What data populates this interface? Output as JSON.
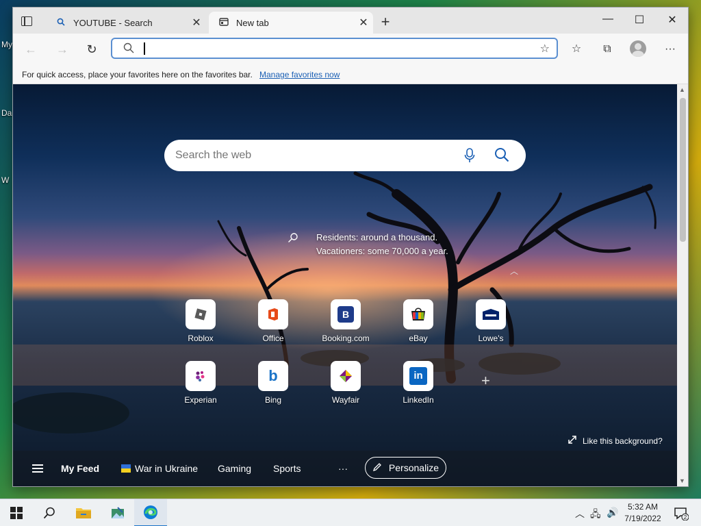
{
  "desktop": {
    "labels": [
      "My",
      "Da",
      "W"
    ]
  },
  "browser": {
    "tabs": [
      {
        "title": "YOUTUBE - Search",
        "active": false
      },
      {
        "title": "New tab",
        "active": true
      }
    ],
    "address": {
      "value": "",
      "placeholder": ""
    },
    "favorites_bar": {
      "message": "For quick access, place your favorites here on the favorites bar.",
      "link": "Manage favorites now"
    }
  },
  "new_tab": {
    "search": {
      "placeholder": "Search the web"
    },
    "fact": {
      "line1": "Residents: around a thousand.",
      "line2": "Vacationers: some 70,000 a year."
    },
    "tiles": [
      {
        "label": "Roblox",
        "icon": "roblox-icon"
      },
      {
        "label": "Office",
        "icon": "office-icon"
      },
      {
        "label": "Booking.com",
        "icon": "booking-icon",
        "glyph": "B"
      },
      {
        "label": "eBay",
        "icon": "ebay-icon"
      },
      {
        "label": "Lowe's",
        "icon": "lowes-icon"
      },
      {
        "label": "Experian",
        "icon": "experian-icon"
      },
      {
        "label": "Bing",
        "icon": "bing-icon",
        "glyph": "b"
      },
      {
        "label": "Wayfair",
        "icon": "wayfair-icon"
      },
      {
        "label": "LinkedIn",
        "icon": "linkedin-icon",
        "glyph": "in"
      }
    ],
    "like_background": "Like this background?",
    "feed": {
      "my_feed": "My Feed",
      "items": [
        "War in Ukraine",
        "Gaming",
        "Sports"
      ],
      "more": "···",
      "personalize": "Personalize"
    }
  },
  "taskbar": {
    "time": "5:32 AM",
    "date": "7/19/2022",
    "notification_count": "2"
  }
}
